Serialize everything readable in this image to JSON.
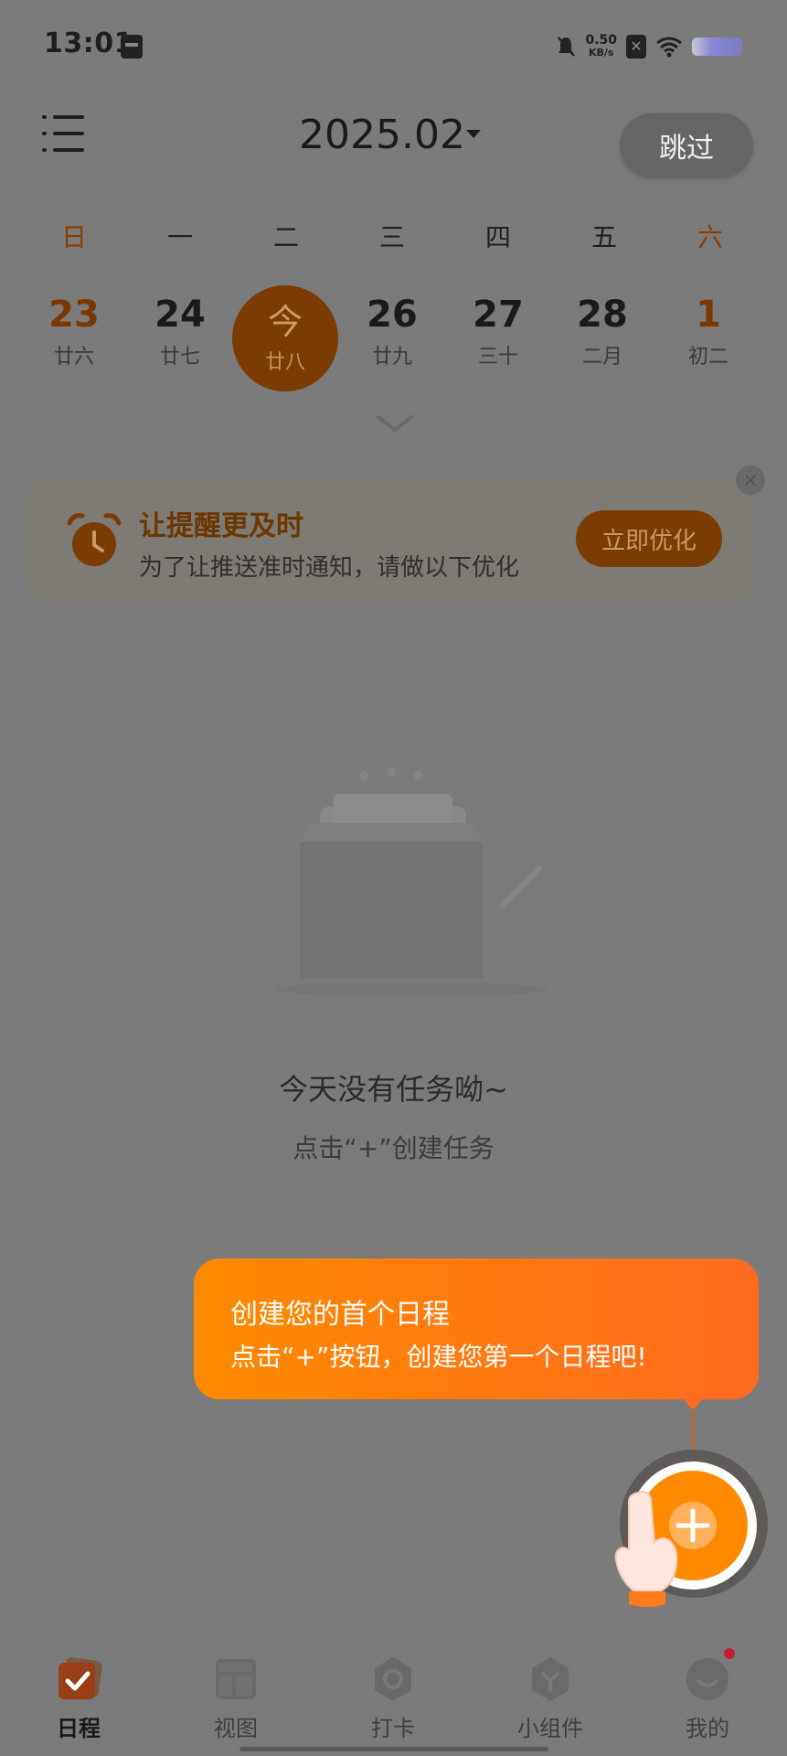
{
  "status_bar": {
    "time": "13:01",
    "net_speed_value": "0.50",
    "net_speed_unit": "KB/s"
  },
  "header": {
    "month": "2025.02",
    "skip_label": "跳过",
    "sort_icon": "sort-icon"
  },
  "weekdays": [
    "日",
    "一",
    "二",
    "三",
    "四",
    "五",
    "六"
  ],
  "days": [
    {
      "num": "23",
      "lunar": "廿六"
    },
    {
      "num": "24",
      "lunar": "廿七"
    },
    {
      "num": "今",
      "lunar": "廿八"
    },
    {
      "num": "26",
      "lunar": "廿九"
    },
    {
      "num": "27",
      "lunar": "三十"
    },
    {
      "num": "28",
      "lunar": "二月"
    },
    {
      "num": "1",
      "lunar": "初二"
    }
  ],
  "reminder": {
    "title": "让提醒更及时",
    "subtitle": "为了让推送准时通知，请做以下优化",
    "button": "立即优化",
    "close_symbol": "×"
  },
  "empty_state": {
    "title": "今天没有任务呦~",
    "subtitle": "点击“+”创建任务"
  },
  "tooltip": {
    "title": "创建您的首个日程",
    "body": "点击“+”按钮，创建您第一个日程吧!"
  },
  "bottom_nav": {
    "items": [
      {
        "label": "日程",
        "icon": "schedule-icon"
      },
      {
        "label": "视图",
        "icon": "view-icon"
      },
      {
        "label": "打卡",
        "icon": "checkin-icon"
      },
      {
        "label": "小组件",
        "icon": "widget-icon"
      },
      {
        "label": "我的",
        "icon": "profile-icon"
      }
    ]
  },
  "colors": {
    "accent": "#ff8a00",
    "dim_overlay": "#7b7b7b",
    "today_dim": "#7a3c00"
  }
}
